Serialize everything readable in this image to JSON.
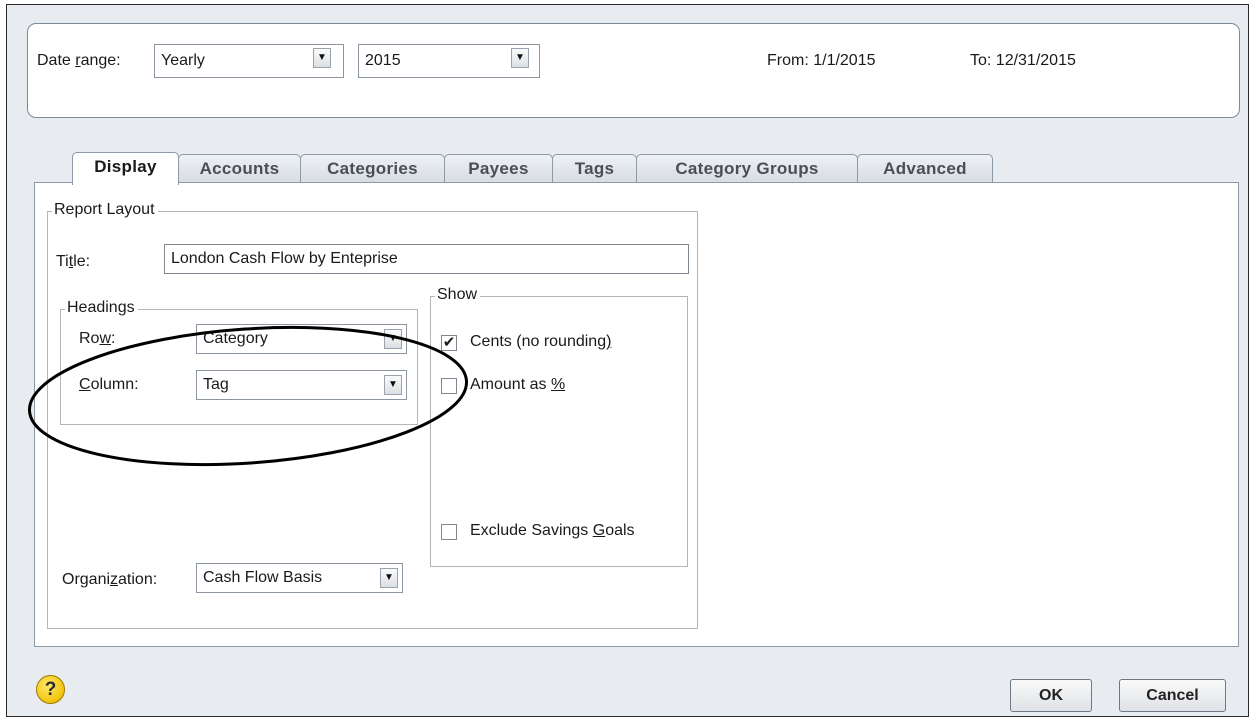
{
  "date": {
    "label_before": "Date ",
    "label_access": "r",
    "label_after": "ange:",
    "range_value": "Yearly",
    "year_value": "2015",
    "from_text": "From: 1/1/2015",
    "to_text": "To: 12/31/2015"
  },
  "tabs": [
    {
      "label": "Display",
      "active": true
    },
    {
      "label": "Accounts"
    },
    {
      "label": "Categories"
    },
    {
      "label": "Payees"
    },
    {
      "label": "Tags"
    },
    {
      "label": "Category Groups"
    },
    {
      "label": "Advanced"
    }
  ],
  "report_layout": {
    "group_title": "Report Layout",
    "title_label_before": "Ti",
    "title_label_access": "t",
    "title_label_after": "le:",
    "title_value": "London Cash Flow by Enteprise",
    "headings": {
      "group_title": "Headings",
      "row_label_before": "Ro",
      "row_label_access": "w",
      "row_label_after": ":",
      "row_value": "Category",
      "column_label_access": "C",
      "column_label_after": "olumn:",
      "column_value": "Tag"
    },
    "organization": {
      "label_before": "Organi",
      "label_access": "z",
      "label_after": "ation:",
      "value": "Cash Flow Basis"
    }
  },
  "show": {
    "group_title": "Show",
    "cents_label_before": "Cents (no rounding",
    "cents_label_access": ")",
    "cents_checked": true,
    "amount_label_before": "Amount as ",
    "amount_label_access": "%",
    "amount_checked": false,
    "exclude_label_before": "Exclude Savings ",
    "exclude_label_access": "G",
    "exclude_label_after": "oals",
    "exclude_checked": false
  },
  "footer": {
    "help_glyph": "?",
    "ok_label": "OK",
    "cancel_label": "Cancel"
  }
}
